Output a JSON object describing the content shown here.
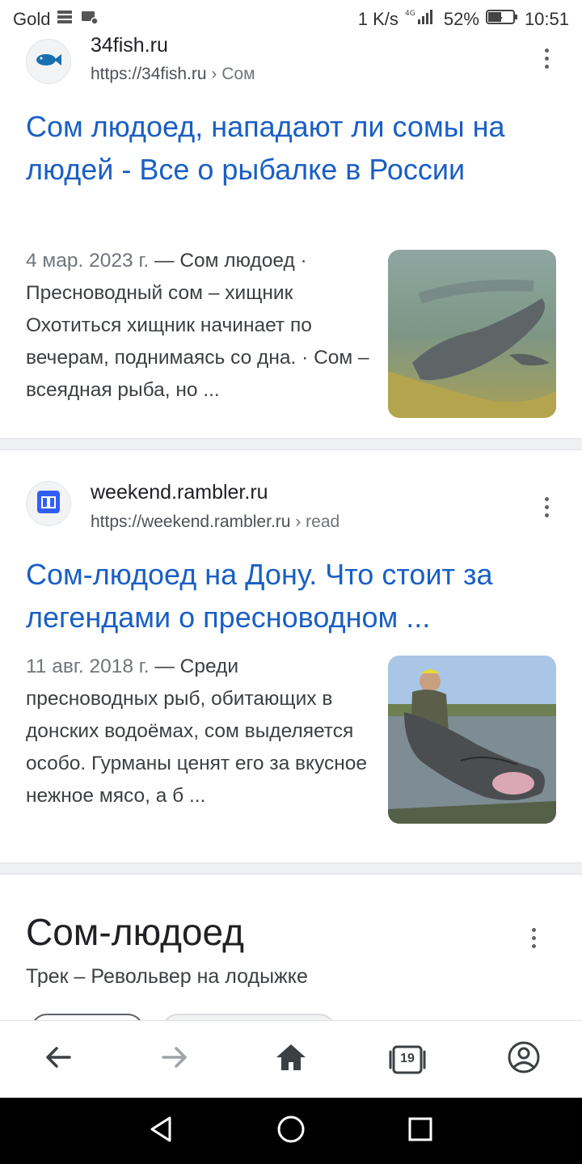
{
  "status_bar": {
    "carrier": "Gold",
    "speed": "1 K/s",
    "network": "4G",
    "battery": "52%",
    "time": "10:51"
  },
  "results": [
    {
      "site_name": "34fish.ru",
      "url": "https://34fish.ru",
      "breadcrumb": "› Сом",
      "favicon": "fish-icon",
      "title": "Сом людоед, нападают ли сомы на людей - Все о рыбалке в России",
      "date": "4 мар. 2023 г.",
      "snippet": " — Сом людоед · Пресноводный сом – хищник Охотиться хищник начинает по вечерам, поднимаясь со дна. · Сом – всеядная рыба, но ..."
    },
    {
      "site_name": "weekend.rambler.ru",
      "url": "https://weekend.rambler.ru",
      "breadcrumb": "› read",
      "favicon": "book-icon",
      "title": "Сом-людоед на Дону. Что стоит за легендами о пресноводном ...",
      "date": "11 авг. 2018 г.",
      "snippet": " — Среди пресноводных рыб, обитающих в донских водоёмах, сом выделяется особо. Гурманы ценят его за вкусное нежное мясо, а б ..."
    }
  ],
  "knowledge_panel": {
    "title": "Сом-людоед",
    "subtitle": "Трек – Револьвер на лодыжке"
  },
  "bottom_nav": {
    "tab_count": "19"
  },
  "colors": {
    "link": "#1a5fc4",
    "text": "#202124",
    "muted": "#70757a"
  }
}
